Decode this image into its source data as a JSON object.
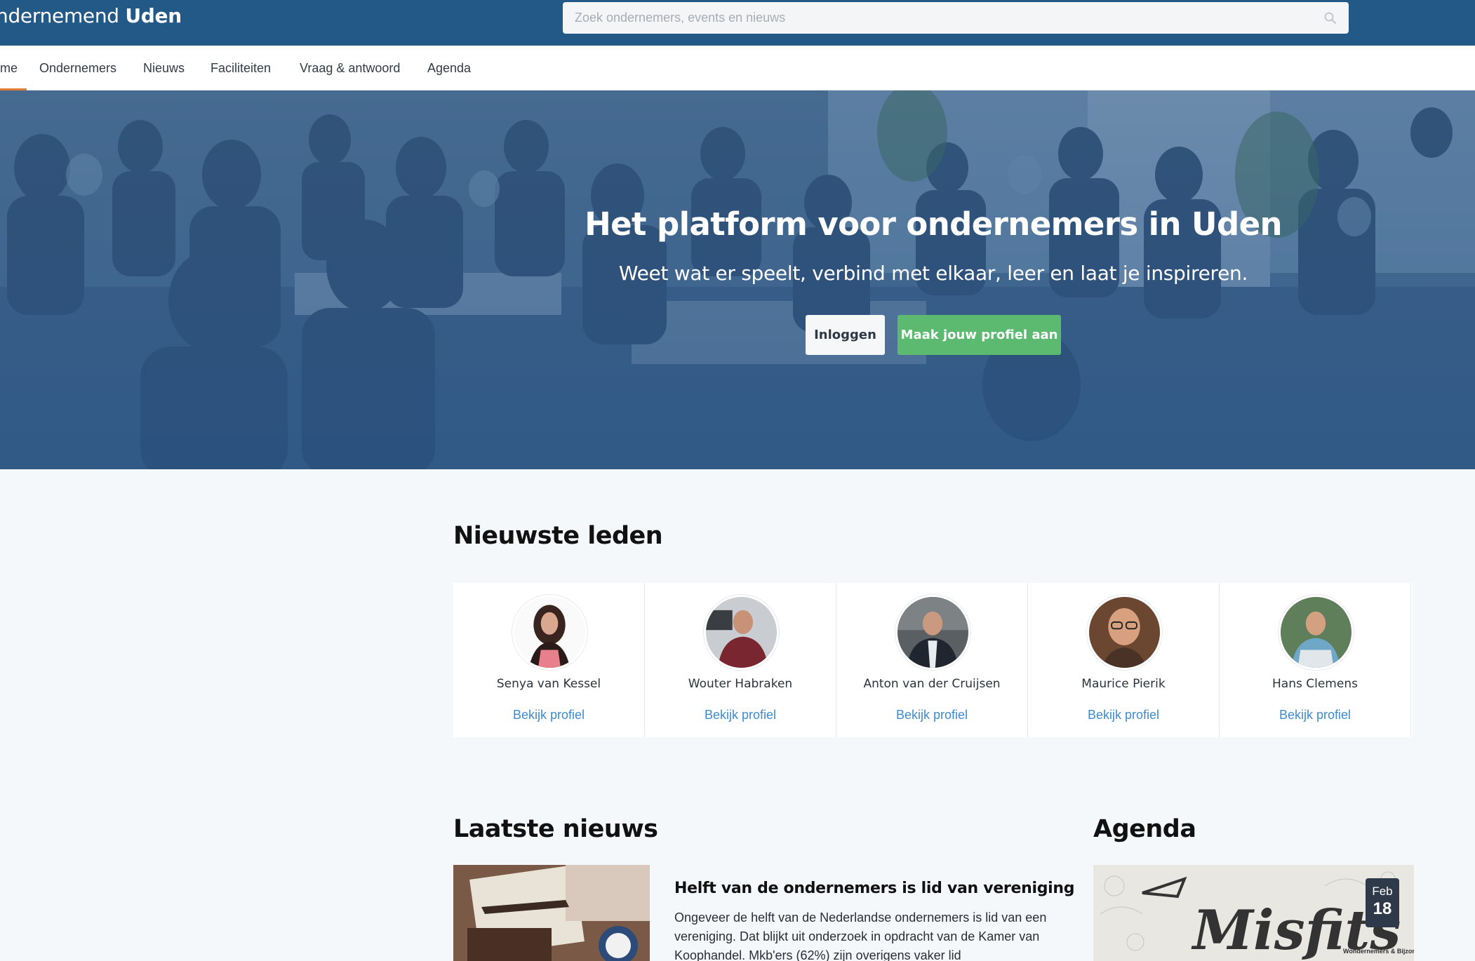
{
  "header": {
    "logo_part1": "ndernemend ",
    "logo_part2": "Uden",
    "search_placeholder": "Zoek ondernemers, events en nieuws"
  },
  "nav": {
    "items": [
      {
        "label": "me",
        "active": true
      },
      {
        "label": "Ondernemers"
      },
      {
        "label": "Nieuws"
      },
      {
        "label": "Faciliteiten"
      },
      {
        "label": "Vraag & antwoord"
      },
      {
        "label": "Agenda"
      }
    ]
  },
  "hero": {
    "title": "Het platform voor ondernemers in Uden",
    "subtitle": "Weet wat er speelt, verbind met elkaar, leer en laat je inspireren.",
    "login_label": "Inloggen",
    "profile_label": "Maak jouw profiel aan"
  },
  "members": {
    "title": "Nieuwste leden",
    "link_label": "Bekijk profiel",
    "items": [
      {
        "name": "Senya van Kessel"
      },
      {
        "name": "Wouter Habraken"
      },
      {
        "name": "Anton van der Cruijsen"
      },
      {
        "name": "Maurice Pierik"
      },
      {
        "name": "Hans Clemens"
      }
    ]
  },
  "news": {
    "title": "Laatste nieuws",
    "item_title": "Helft van de ondernemers is lid van vereniging",
    "item_body": "Ongeveer de helft van de Nederlandse ondernemers is lid van een vereniging. Dat blijkt uit onderzoek in opdracht van de Kamer van Koophandel. Mkb'ers (62%) zijn overigens vaker lid"
  },
  "agenda": {
    "title": "Agenda",
    "month": "Feb",
    "day": "18",
    "image_text": "Misfits",
    "image_sub": "Wondernemers & Bijzondernemers"
  },
  "colors": {
    "topbar": "#235987",
    "accent_orange": "#e07b34",
    "green": "#5bba6f",
    "link_blue": "#3e8bd0"
  }
}
